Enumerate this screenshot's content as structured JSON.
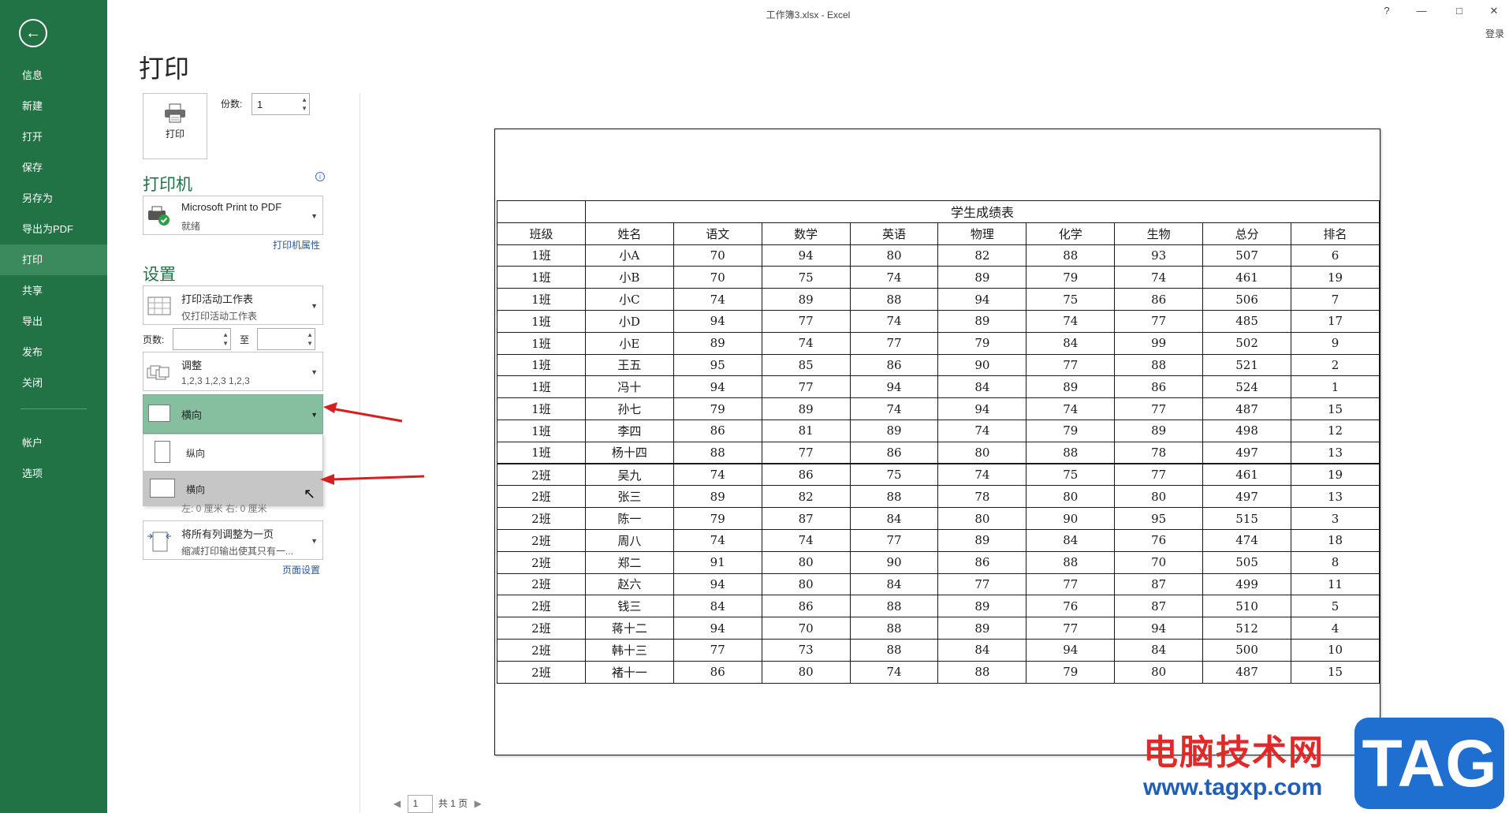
{
  "window": {
    "title": "工作簿3.xlsx - Excel",
    "help": "?",
    "login": "登录"
  },
  "nav": {
    "items": [
      "信息",
      "新建",
      "打开",
      "保存",
      "另存为",
      "导出为PDF",
      "打印",
      "共享",
      "导出",
      "发布",
      "关闭"
    ],
    "bottom_items": [
      "帐户",
      "选项"
    ],
    "active": "打印"
  },
  "print": {
    "heading": "打印",
    "button_label": "打印",
    "copies_label": "份数:",
    "copies_value": "1"
  },
  "printer": {
    "section": "打印机",
    "name": "Microsoft Print to PDF",
    "status": "就绪",
    "properties_link": "打印机属性"
  },
  "settings": {
    "section": "设置",
    "scope_title": "打印活动工作表",
    "scope_sub": "仅打印活动工作表",
    "pages_label": "页数:",
    "to_label": "至",
    "collate_title": "调整",
    "collate_sub": "1,2,3    1,2,3    1,2,3",
    "orientation_selected": "横向",
    "orientation_options": [
      "纵向",
      "横向"
    ],
    "margins_ghost": "左: 0 厘米    右: 0 厘米",
    "scaling_title": "将所有列调整为一页",
    "scaling_sub": "缩减打印输出使其只有一...",
    "page_setup_link": "页面设置"
  },
  "preview": {
    "table_title": "学生成绩表",
    "headers": [
      "班级",
      "姓名",
      "语文",
      "数学",
      "英语",
      "物理",
      "化学",
      "生物",
      "总分",
      "排名"
    ],
    "rows": [
      [
        "1班",
        "小A",
        "70",
        "94",
        "80",
        "82",
        "88",
        "93",
        "507",
        "6"
      ],
      [
        "1班",
        "小B",
        "70",
        "75",
        "74",
        "89",
        "79",
        "74",
        "461",
        "19"
      ],
      [
        "1班",
        "小C",
        "74",
        "89",
        "88",
        "94",
        "75",
        "86",
        "506",
        "7"
      ],
      [
        "1班",
        "小D",
        "94",
        "77",
        "74",
        "89",
        "74",
        "77",
        "485",
        "17"
      ],
      [
        "1班",
        "小E",
        "89",
        "74",
        "77",
        "79",
        "84",
        "99",
        "502",
        "9"
      ],
      [
        "1班",
        "王五",
        "95",
        "85",
        "86",
        "90",
        "77",
        "88",
        "521",
        "2"
      ],
      [
        "1班",
        "冯十",
        "94",
        "77",
        "94",
        "84",
        "89",
        "86",
        "524",
        "1"
      ],
      [
        "1班",
        "孙七",
        "79",
        "89",
        "74",
        "94",
        "74",
        "77",
        "487",
        "15"
      ],
      [
        "1班",
        "李四",
        "86",
        "81",
        "89",
        "74",
        "79",
        "89",
        "498",
        "12"
      ],
      [
        "1班",
        "杨十四",
        "88",
        "77",
        "86",
        "80",
        "88",
        "78",
        "497",
        "13"
      ],
      [
        "2班",
        "吴九",
        "74",
        "86",
        "75",
        "74",
        "75",
        "77",
        "461",
        "19"
      ],
      [
        "2班",
        "张三",
        "89",
        "82",
        "88",
        "78",
        "80",
        "80",
        "497",
        "13"
      ],
      [
        "2班",
        "陈一",
        "79",
        "87",
        "84",
        "80",
        "90",
        "95",
        "515",
        "3"
      ],
      [
        "2班",
        "周八",
        "74",
        "74",
        "77",
        "89",
        "84",
        "76",
        "474",
        "18"
      ],
      [
        "2班",
        "郑二",
        "91",
        "80",
        "90",
        "86",
        "88",
        "70",
        "505",
        "8"
      ],
      [
        "2班",
        "赵六",
        "94",
        "80",
        "84",
        "77",
        "77",
        "87",
        "499",
        "11"
      ],
      [
        "2班",
        "钱三",
        "84",
        "86",
        "88",
        "89",
        "76",
        "87",
        "510",
        "5"
      ],
      [
        "2班",
        "蒋十二",
        "94",
        "70",
        "88",
        "89",
        "77",
        "94",
        "512",
        "4"
      ],
      [
        "2班",
        "韩十三",
        "77",
        "73",
        "88",
        "84",
        "94",
        "84",
        "500",
        "10"
      ],
      [
        "2班",
        "褚十一",
        "86",
        "80",
        "74",
        "88",
        "79",
        "80",
        "487",
        "15"
      ]
    ]
  },
  "pager": {
    "current": "1",
    "total": "共 1 页"
  },
  "watermark": {
    "site": "电脑技术网",
    "url": "www.tagxp.com",
    "tag": "TAG"
  },
  "colors": {
    "nav_bg": "#217346",
    "accent": "#217346",
    "selected_orientation": "#86bfa0",
    "annotation_arrow": "#d62020"
  }
}
